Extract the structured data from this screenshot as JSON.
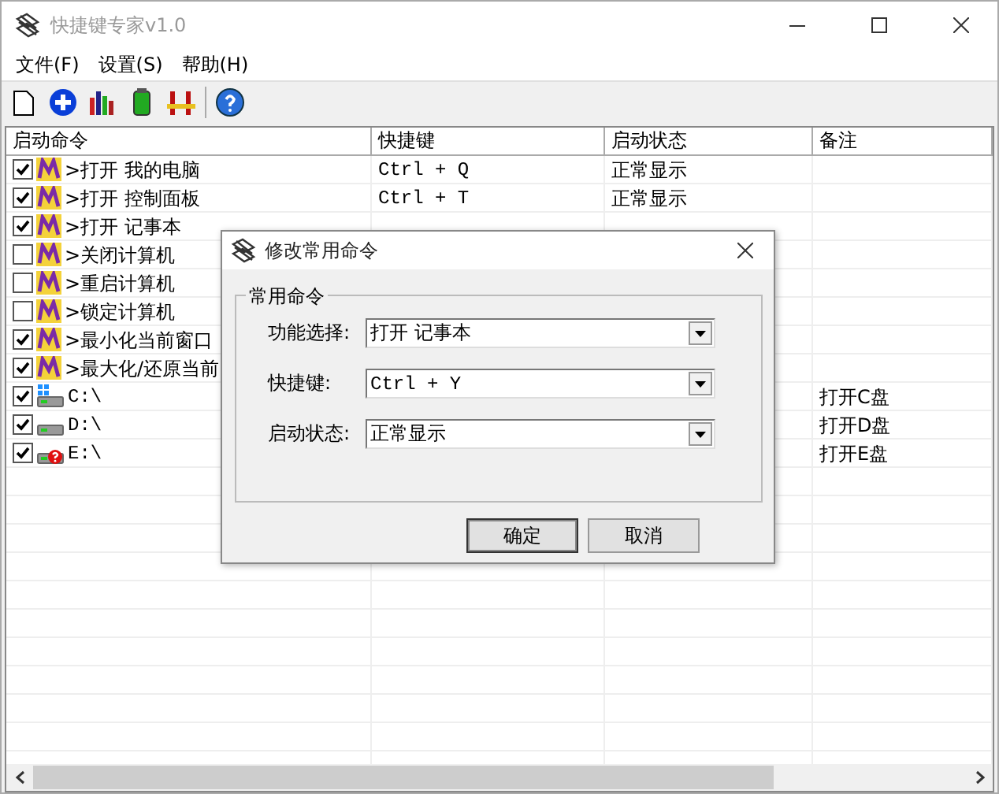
{
  "window": {
    "title": "快捷键专家v1.0"
  },
  "menu": [
    "文件(F)",
    "设置(S)",
    "帮助(H)"
  ],
  "table": {
    "columns": [
      "启动命令",
      "快捷键",
      "启动状态",
      "备注"
    ],
    "rows": [
      {
        "kind": "command",
        "checked": true,
        "command": ">打开 我的电脑",
        "shortcut": "Ctrl + Q",
        "status": "正常显示"
      },
      {
        "kind": "command",
        "checked": true,
        "command": ">打开 控制面板",
        "shortcut": "Ctrl + T",
        "status": "正常显示"
      },
      {
        "kind": "command",
        "checked": true,
        "command": ">打开 记事本"
      },
      {
        "kind": "command",
        "checked": false,
        "command": ">关闭计算机"
      },
      {
        "kind": "command",
        "checked": false,
        "command": ">重启计算机"
      },
      {
        "kind": "command",
        "checked": false,
        "command": ">锁定计算机"
      },
      {
        "kind": "command",
        "checked": true,
        "command": ">最小化当前窗口"
      },
      {
        "kind": "command",
        "checked": true,
        "command": ">最大化/还原当前"
      },
      {
        "kind": "system_drive",
        "checked": true,
        "command": "C:\\",
        "note": "打开C盘"
      },
      {
        "kind": "drive",
        "checked": true,
        "command": "D:\\",
        "note": "打开D盘"
      },
      {
        "kind": "missing_drive",
        "checked": true,
        "command": "E:\\",
        "note": "打开E盘"
      }
    ]
  },
  "dialog": {
    "title": "修改常用命令",
    "group": "常用命令",
    "fields": [
      {
        "label": "功能选择:",
        "value": "打开 记事本",
        "mono": false
      },
      {
        "label": "快捷键:",
        "value": "Ctrl + Y",
        "mono": true
      },
      {
        "label": "启动状态:",
        "value": "正常显示"
      }
    ],
    "buttons": [
      {
        "label": "确定",
        "default": true
      },
      {
        "label": "取消",
        "default": false
      }
    ]
  }
}
